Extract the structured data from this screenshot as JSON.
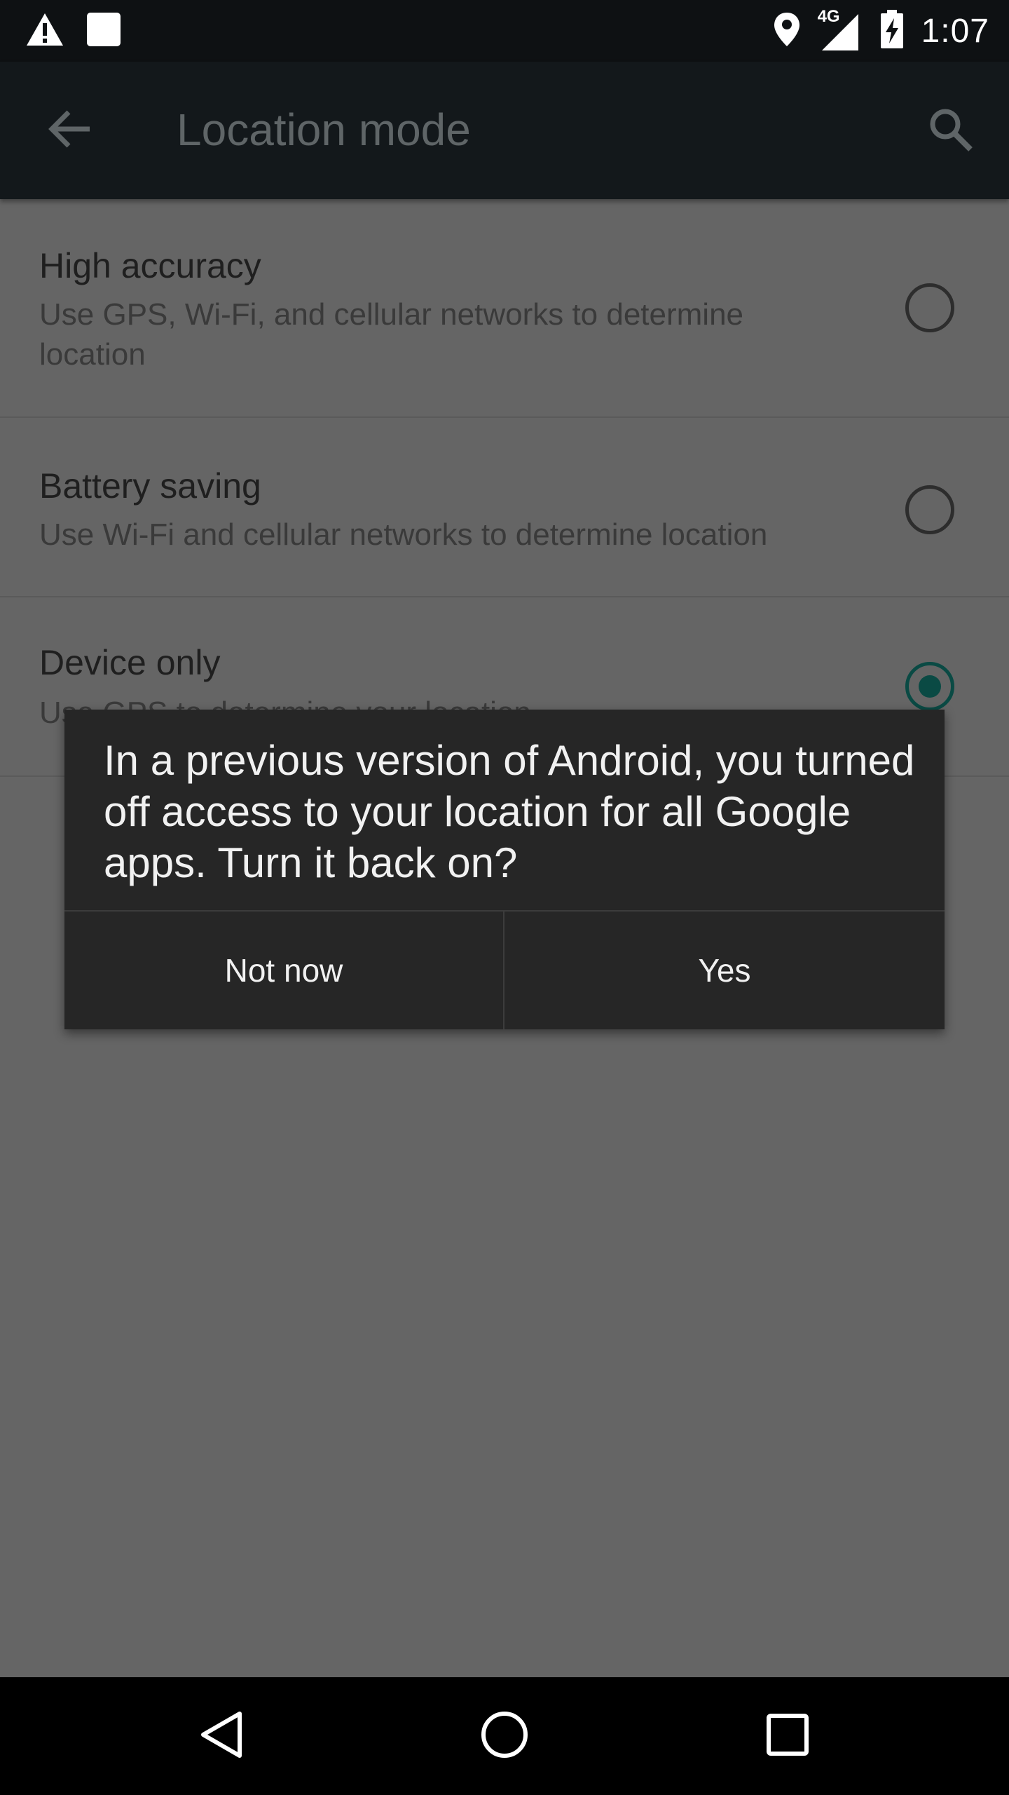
{
  "status_bar": {
    "time": "1:07",
    "network_label": "4G",
    "left_icons": [
      "warning-icon",
      "notification-square-icon"
    ],
    "right_icons": [
      "location-pin-icon",
      "signal-4g-icon",
      "battery-charging-icon"
    ]
  },
  "app_bar": {
    "title": "Location mode",
    "back_icon": "arrow-back-icon",
    "search_icon": "search-icon"
  },
  "options": [
    {
      "title": "High accuracy",
      "summary": "Use GPS, Wi-Fi, and cellular networks to determine location",
      "selected": false
    },
    {
      "title": "Battery saving",
      "summary": "Use Wi-Fi and cellular networks to determine location",
      "selected": false
    },
    {
      "title": "Device only",
      "summary": "Use GPS to determine your location",
      "selected": true
    }
  ],
  "dialog": {
    "message": "In a previous version of Android, you turned off access to your location for all Google apps. Turn it back on?",
    "negative_label": "Not now",
    "positive_label": "Yes"
  },
  "nav_bar": {
    "icons": [
      "back-triangle-icon",
      "home-circle-icon",
      "recents-square-icon"
    ]
  },
  "colors": {
    "scrim_background": "#656565",
    "app_bar": "#13181b",
    "status_bar": "#0e1113",
    "dialog_background": "#262626",
    "accent_radio": "#0a4a44"
  }
}
